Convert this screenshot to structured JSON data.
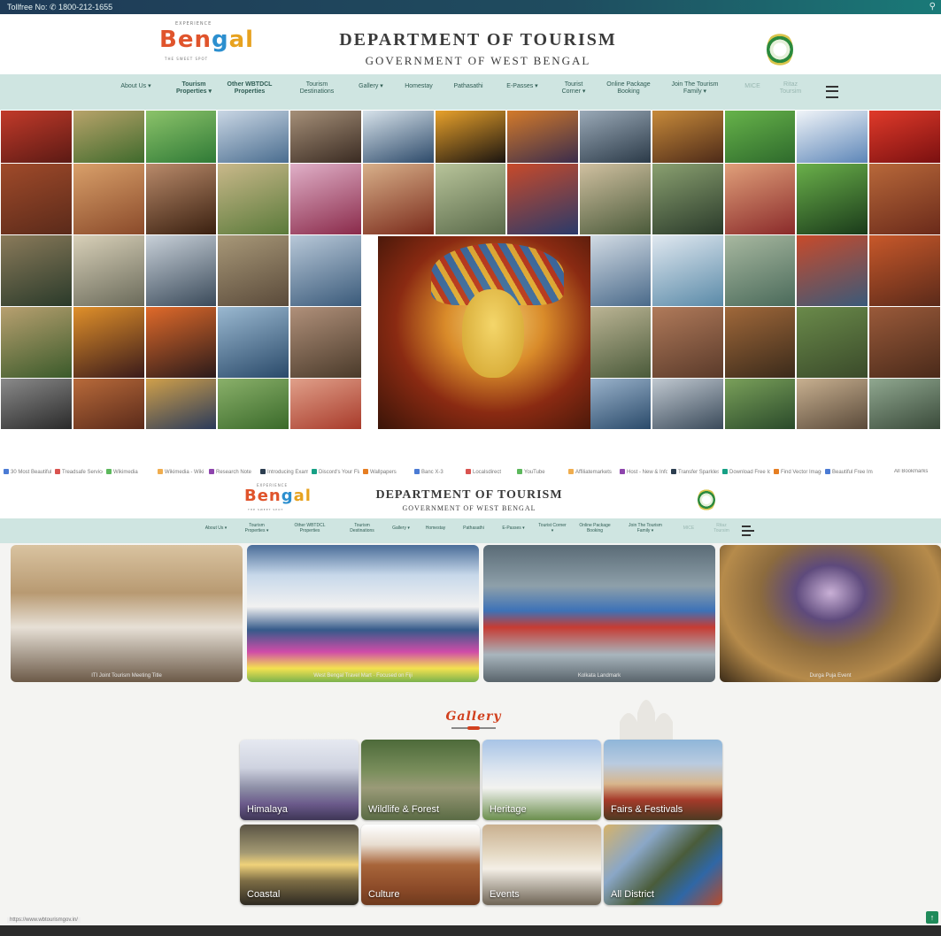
{
  "topbar": {
    "tollfree": "Tollfree No: ✆ 1800-212-1655",
    "search_icon": "search-icon"
  },
  "header": {
    "logo_small": "EXPERIENCE",
    "logo_text": "Bengal",
    "logo_tag": "THE SWEET SPOT",
    "title_line1": "DEPARTMENT OF TOURISM",
    "title_line2": "GOVERNMENT OF WEST BENGAL",
    "emblem_icon": "state-emblem-icon"
  },
  "nav": {
    "items": [
      {
        "label": "About Us ▾"
      },
      {
        "label": "Tourism Properties ▾"
      },
      {
        "label": "Other WBTDCL Properties"
      },
      {
        "label": "Tourism Destinations"
      },
      {
        "label": "Gallery ▾"
      },
      {
        "label": "Homestay"
      },
      {
        "label": "Pathasathi"
      },
      {
        "label": "E-Passes ▾"
      },
      {
        "label": "Tourist Corner ▾"
      },
      {
        "label": "Online Package Booking"
      },
      {
        "label": "Join The Tourism Family ▾"
      },
      {
        "label": "MICE"
      },
      {
        "label": "Ritaz Toursim"
      }
    ],
    "menu_icon": "hamburger-icon"
  },
  "bookmarks": [
    "30 Most Beautiful...",
    "Treadsafe Service",
    "Wikimedia",
    "Wikimedia - Wiki",
    "Research Note",
    "Introducing Exam",
    "Discord's Your Fla",
    "Wallpapers",
    "Banc X-3",
    "Localsdirect",
    "YouTube",
    "Affiliatemarkets",
    "Host - New & Info",
    "Transfer Sparkles",
    "Download Free Ico",
    "Find Vector Image",
    "Beautiful Free Ima"
  ],
  "bookmarks_more": "All Bookmarks",
  "events": [
    {
      "caption": "ITI Joint Tourism Meeting Title"
    },
    {
      "caption": "West Bengal Travel Mart · Focused on Fiji"
    },
    {
      "caption": "Kolkata Landmark"
    },
    {
      "caption": "Durga Puja Event"
    }
  ],
  "gallery": {
    "title": "Gallery",
    "cards": [
      {
        "label": "Himalaya"
      },
      {
        "label": "Wildlife & Forest"
      },
      {
        "label": "Heritage"
      },
      {
        "label": "Fairs & Festivals"
      },
      {
        "label": "Coastal"
      },
      {
        "label": "Culture"
      },
      {
        "label": "Events"
      },
      {
        "label": "All District"
      }
    ]
  },
  "status_url": "https://www.wbtourismgov.in/",
  "scroll_top_label": "↑"
}
